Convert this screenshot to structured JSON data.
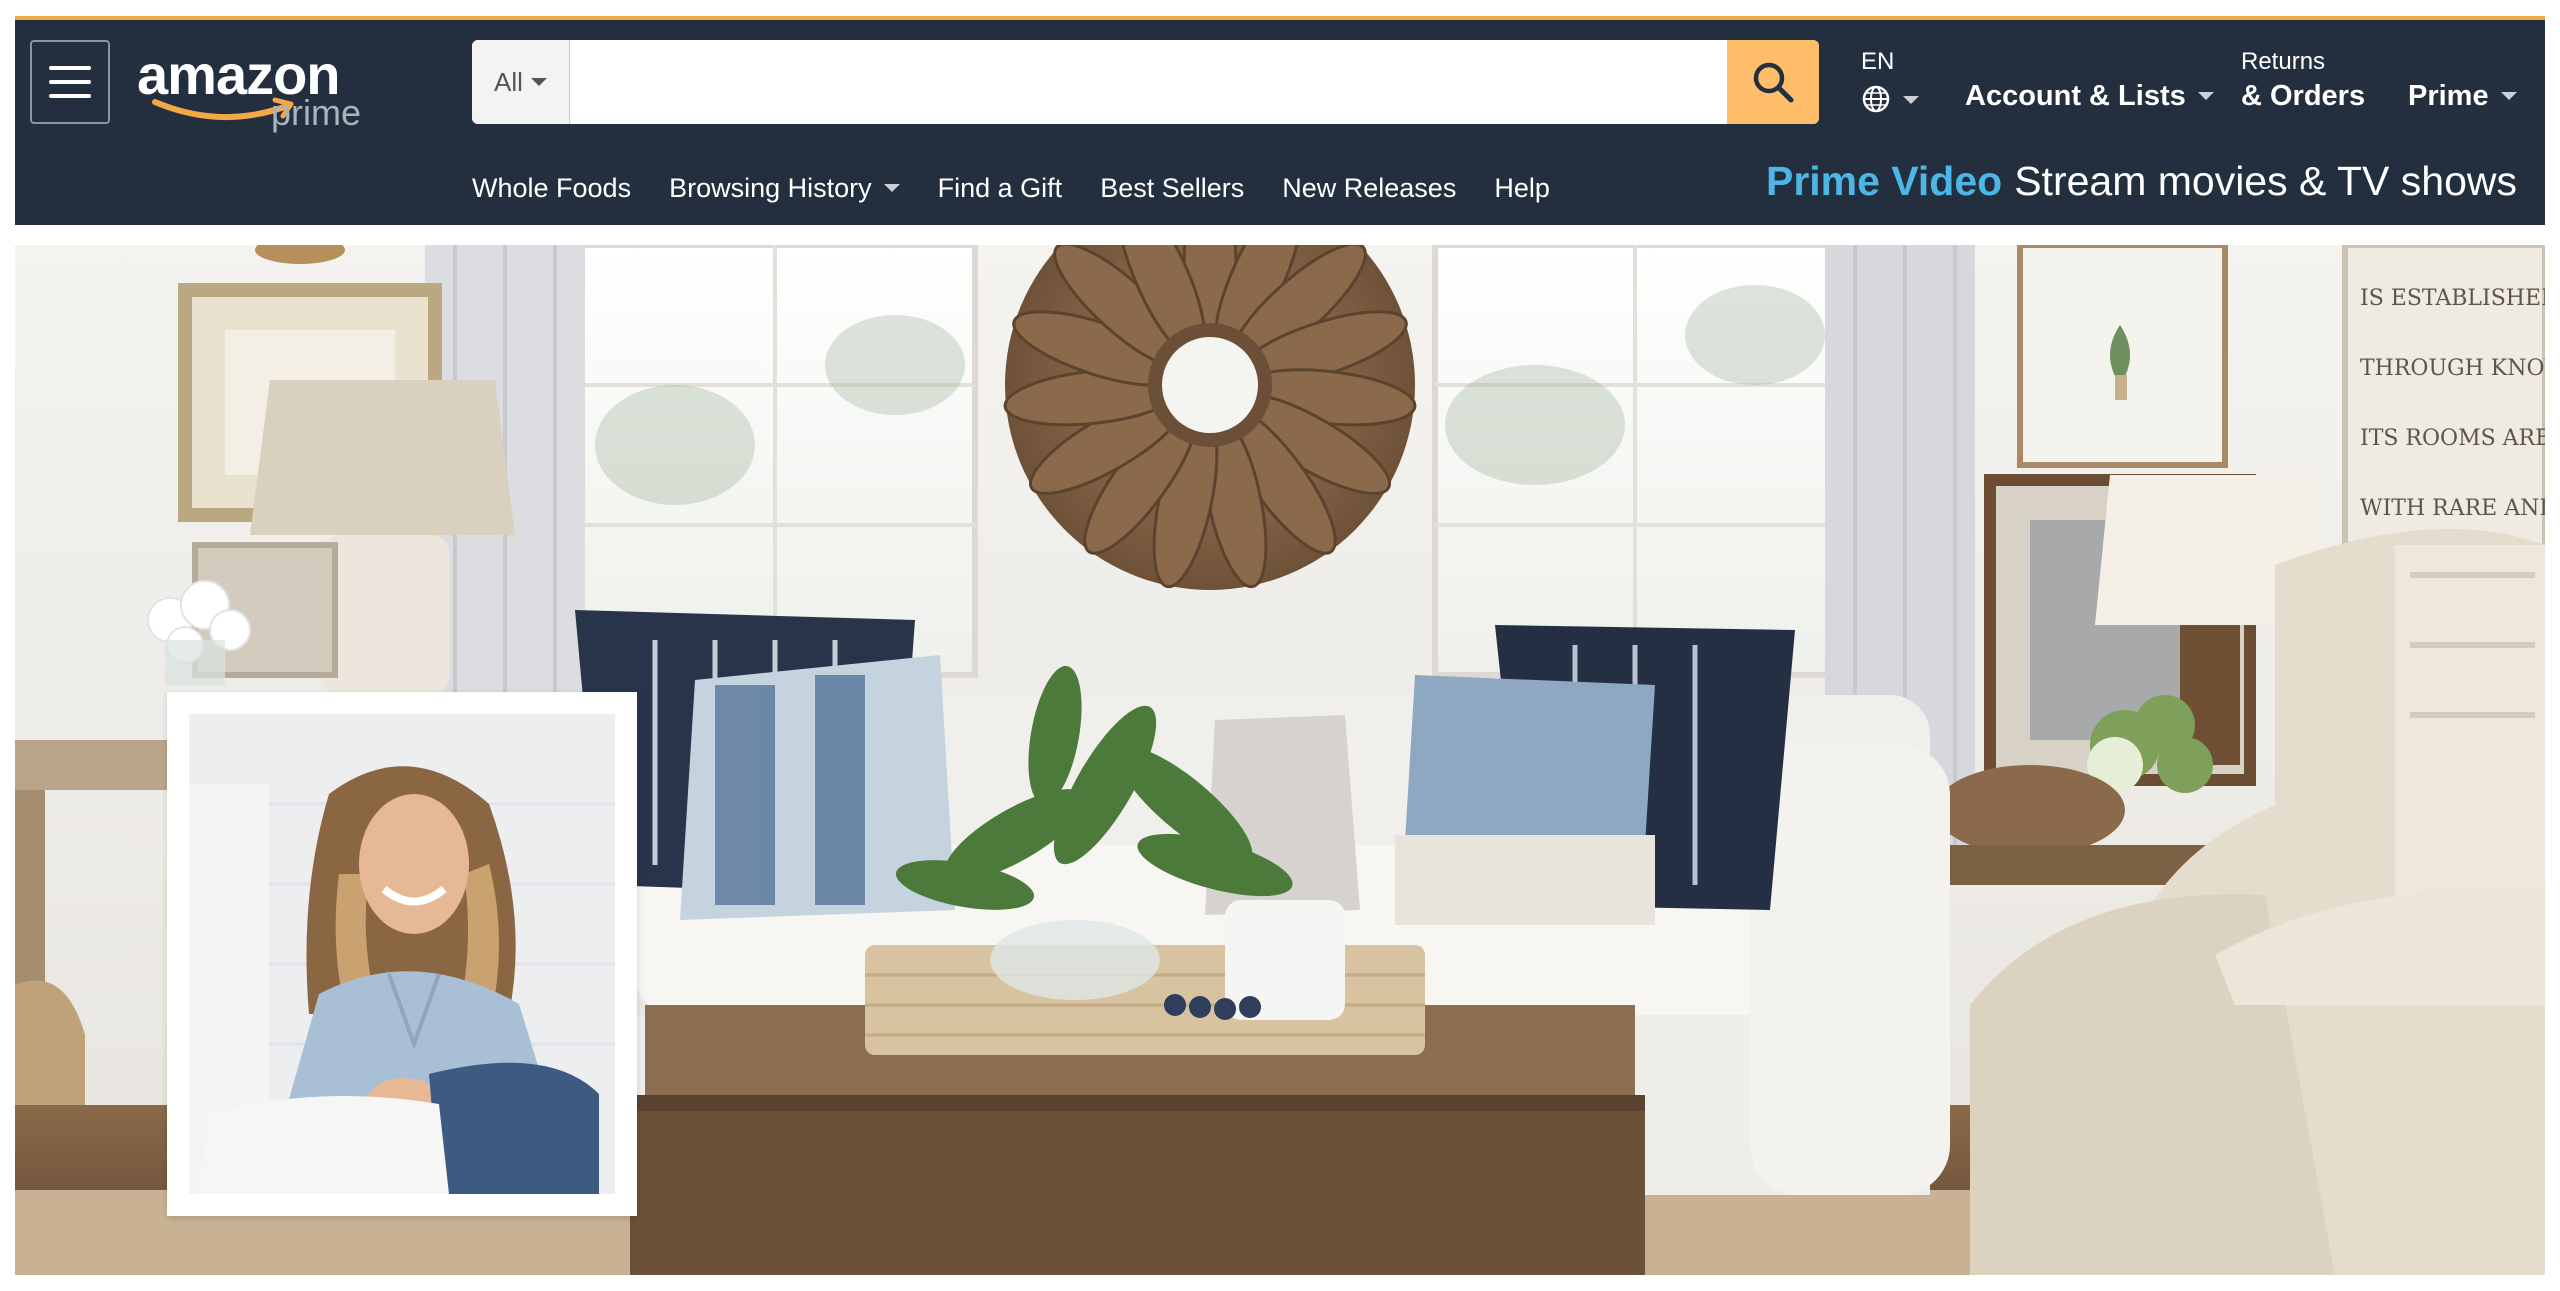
{
  "header": {
    "logo": {
      "wordmark": "amazon",
      "submark": "prime"
    },
    "menu_icon": "hamburger-menu-icon",
    "search": {
      "department": "All",
      "placeholder": "",
      "value": "",
      "button_icon": "search-icon"
    },
    "language": {
      "code": "EN",
      "icon": "globe-icon"
    },
    "account": {
      "label": "Account & Lists"
    },
    "returns": {
      "line1": "Returns",
      "line2": "& Orders"
    },
    "prime": {
      "label": "Prime"
    }
  },
  "nav": {
    "items": [
      {
        "label": "Whole Foods",
        "has_dropdown": false
      },
      {
        "label": "Browsing History",
        "has_dropdown": true
      },
      {
        "label": "Find a Gift",
        "has_dropdown": false
      },
      {
        "label": "Best Sellers",
        "has_dropdown": false
      },
      {
        "label": "New Releases",
        "has_dropdown": false
      },
      {
        "label": "Help",
        "has_dropdown": false
      }
    ],
    "promo": {
      "brand": "Prime Video",
      "text": "Stream movies & TV shows"
    }
  },
  "hero": {
    "description_icon": "living-room-banner-image",
    "inset_icon": "portrait-photo"
  },
  "colors": {
    "header_bg": "#232f3e",
    "accent_orange": "#f3a847",
    "search_button": "#febd69",
    "prime_video_blue": "#4cb6e6"
  }
}
